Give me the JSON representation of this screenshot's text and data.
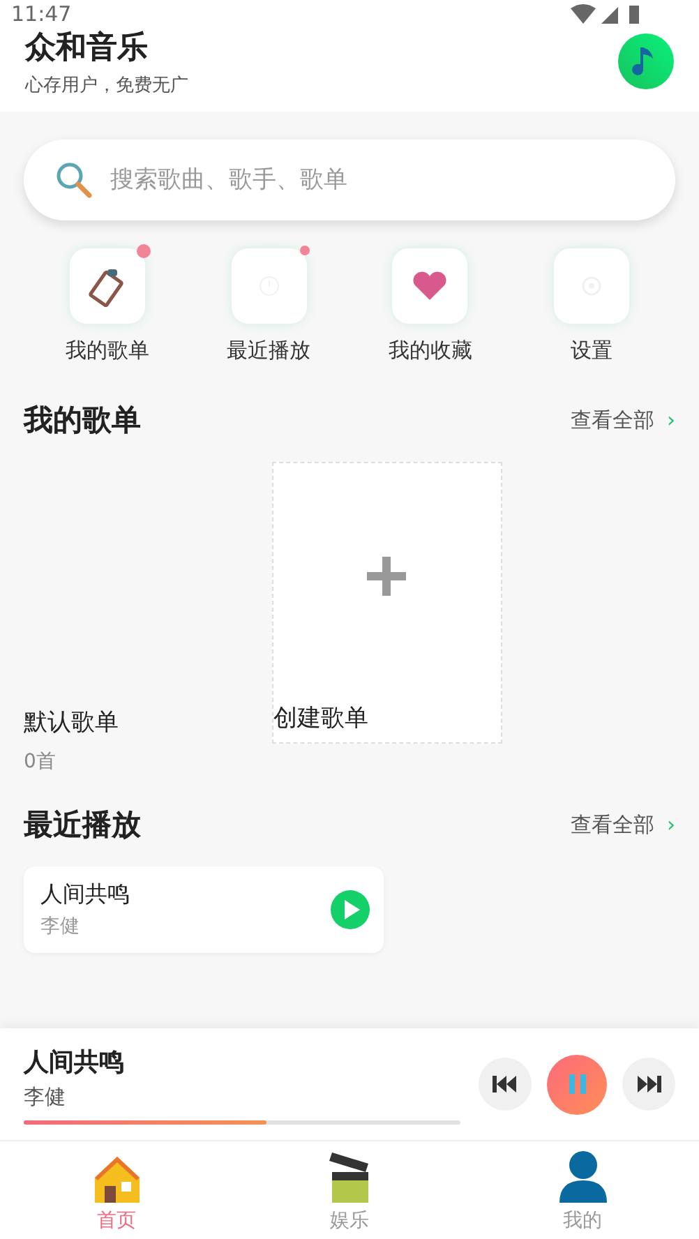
{
  "status_bar": {
    "time": "11:47"
  },
  "header": {
    "title": "众和音乐",
    "subtitle": "心存用户，免费无广"
  },
  "search": {
    "placeholder": "搜索歌曲、歌手、歌单"
  },
  "shortcuts": [
    {
      "kind": "playlist",
      "label": "我的歌单",
      "badge": true
    },
    {
      "kind": "recent",
      "label": "最近播放",
      "badge": true
    },
    {
      "kind": "favorite",
      "label": "我的收藏",
      "badge": false
    },
    {
      "kind": "settings",
      "label": "设置",
      "badge": false
    }
  ],
  "my_playlists": {
    "title": "我的歌单",
    "view_all": "查看全部",
    "arrow": "›",
    "items": [
      {
        "kind": "playlist",
        "name": "默认歌单",
        "count": "0首"
      },
      {
        "kind": "create",
        "name": "创建歌单"
      }
    ]
  },
  "recent": {
    "title": "最近播放",
    "view_all": "查看全部",
    "arrow": "›",
    "items": [
      {
        "title": "人间共鸣",
        "artist": "李健"
      }
    ]
  },
  "player": {
    "title": "人间共鸣",
    "artist": "李健",
    "level": 0.555,
    "playing": true
  },
  "tabs": [
    {
      "kind": "home",
      "label": "首页",
      "selected": true
    },
    {
      "kind": "fun",
      "label": "娱乐",
      "selected": false
    },
    {
      "kind": "me",
      "label": "我的",
      "selected": false
    }
  ]
}
